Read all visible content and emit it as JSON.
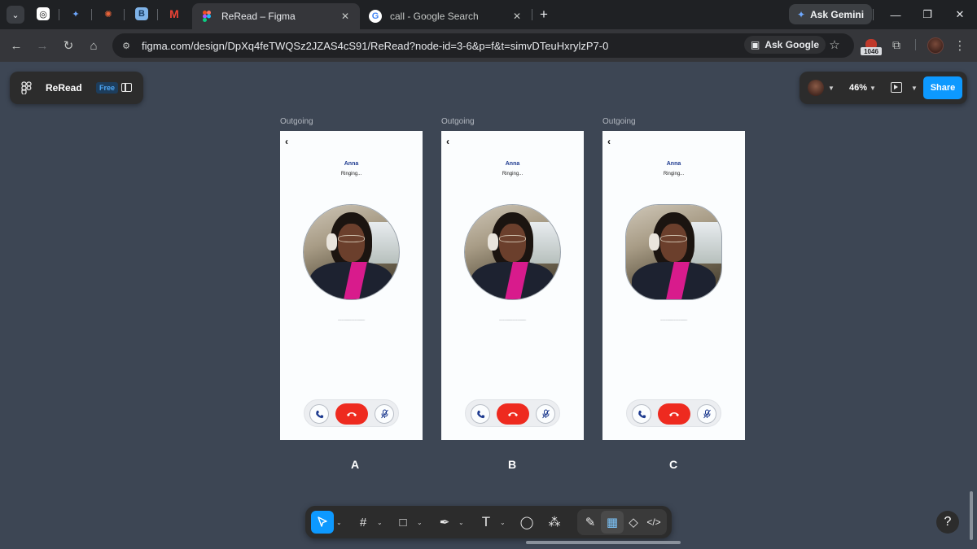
{
  "browser": {
    "tabs": [
      {
        "title": "ReRead – Figma",
        "active": true
      },
      {
        "title": "call - Google Search",
        "active": false
      }
    ],
    "ask_gemini_label": "Ask Gemini",
    "url": "figma.com/design/DpXq4feTWQSz2JZAS4cS91/ReRead?node-id=3-6&p=f&t=simvDTeuHxrylzP7-0",
    "ask_google_label": "Ask Google",
    "extension_badge": "1046"
  },
  "figma": {
    "file_name": "ReRead",
    "plan_badge": "Free",
    "zoom": "46%",
    "share_label": "Share",
    "help_label": "?"
  },
  "frames": [
    {
      "label": "Outgoing",
      "caller": "Anna",
      "status": "Ringing...",
      "dots": "...............................",
      "variant": "A",
      "shape": "circle"
    },
    {
      "label": "Outgoing",
      "caller": "Anna",
      "status": "Ringing...",
      "dots": "...............................",
      "variant": "B",
      "shape": "circle"
    },
    {
      "label": "Outgoing",
      "caller": "Anna",
      "status": "Ringing...",
      "dots": "...............................",
      "variant": "C",
      "shape": "squircle"
    }
  ],
  "colors": {
    "canvas": "#3d4654",
    "accent": "#0d99ff",
    "end_call": "#ee2a1f",
    "caller_name": "#1d3a8f"
  },
  "icons": {
    "tools": [
      "move-icon",
      "frame-icon",
      "rectangle-icon",
      "pen-icon",
      "text-icon",
      "comment-icon",
      "actions-icon"
    ],
    "dev": [
      "draw-icon",
      "design-icon",
      "components-icon",
      "dev-mode-icon"
    ]
  }
}
